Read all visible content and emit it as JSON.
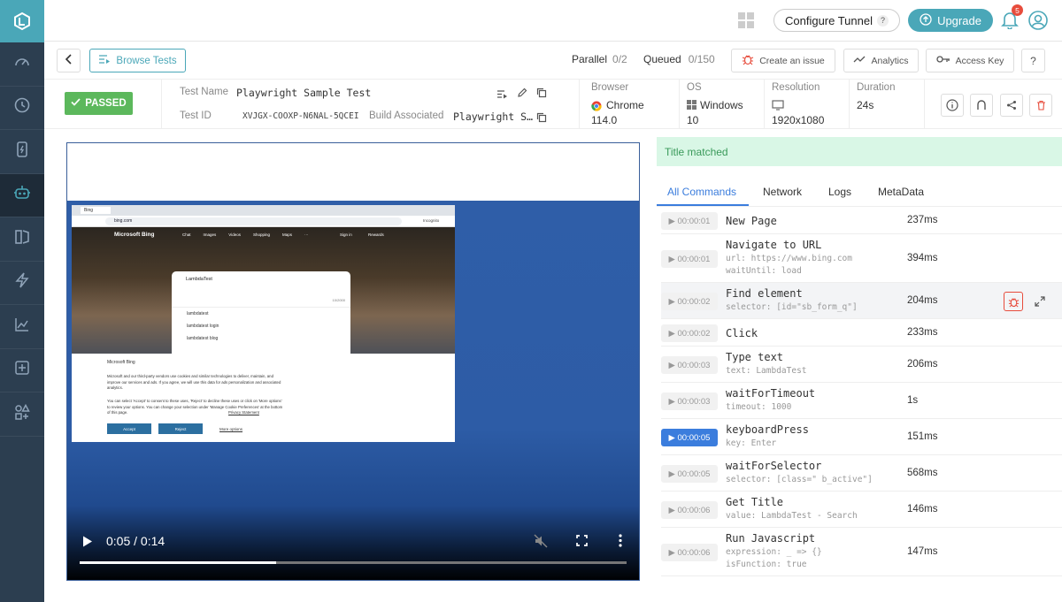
{
  "header": {
    "configure_tunnel": "Configure Tunnel",
    "help_glyph": "?",
    "upgrade": "Upgrade",
    "notifications_count": "5"
  },
  "toolbar": {
    "browse_tests": "Browse Tests",
    "parallel_label": "Parallel",
    "parallel_value": "0/2",
    "queued_label": "Queued",
    "queued_value": "0/150",
    "create_issue": "Create an issue",
    "analytics": "Analytics",
    "access_key": "Access Key",
    "help": "?"
  },
  "test": {
    "status": "PASSED",
    "name_label": "Test Name",
    "name": "Playwright Sample Test",
    "id_label": "Test ID",
    "id": "XVJGX-COOXP-N6NAL-5QCEI",
    "build_label": "Build Associated",
    "build": "Playwright S…",
    "browser_label": "Browser",
    "browser": "Chrome",
    "browser_version": "114.0",
    "os_label": "OS",
    "os": "Windows",
    "os_version": "10",
    "resolution_label": "Resolution",
    "resolution": "1920x1080",
    "duration_label": "Duration",
    "duration": "24s"
  },
  "video": {
    "current": "0:05",
    "total": "0:14",
    "separator": " / ",
    "progress": 0.36
  },
  "page_preview": {
    "tab_title": "Bing",
    "url": "bing.com",
    "incognito": "Incognito",
    "brand": "Microsoft Bing",
    "nav": [
      "Chat",
      "Images",
      "Videos",
      "Shopping",
      "Maps",
      "···"
    ],
    "signin": "Sign in",
    "rewards": "Rewards",
    "query": "LambdaTest",
    "counter": "10/2000",
    "suggestions": [
      "lambdatest",
      "lambdatest login",
      "lambdatest blog"
    ],
    "consent_brand": "Microsoft Bing",
    "consent_text1": "Microsoft and our third-party vendors use cookies and similar technologies to deliver, maintain, and improve our services and ads. If you agree, we will use this data for ads personalization and associated analytics.",
    "consent_text2": "You can select 'Accept' to consent to these uses, 'Reject' to decline these uses or click on 'More options' to review your options. You can change your selection under 'Manage Cookie Preferences' at the bottom of this page.",
    "privacy": "Privacy Statement",
    "accept": "Accept",
    "reject": "Reject",
    "more": "More options"
  },
  "panel": {
    "banner": "Title matched",
    "tabs": [
      "All Commands",
      "Network",
      "Logs",
      "MetaData"
    ],
    "commands": [
      {
        "time": "00:00:01",
        "name": "New Page",
        "details": [],
        "duration": "237ms"
      },
      {
        "time": "00:00:01",
        "name": "Navigate to URL",
        "details": [
          "url: https://www.bing.com",
          "waitUntil: load"
        ],
        "duration": "394ms"
      },
      {
        "time": "00:00:02",
        "name": "Find element",
        "details": [
          "selector: [id=\"sb_form_q\"]"
        ],
        "duration": "204ms"
      },
      {
        "time": "00:00:02",
        "name": "Click",
        "details": [],
        "duration": "233ms"
      },
      {
        "time": "00:00:03",
        "name": "Type text",
        "details": [
          "text: LambdaTest"
        ],
        "duration": "206ms"
      },
      {
        "time": "00:00:03",
        "name": "waitForTimeout",
        "details": [
          "timeout: 1000"
        ],
        "duration": "1s"
      },
      {
        "time": "00:00:05",
        "name": "keyboardPress",
        "details": [
          "key: Enter"
        ],
        "duration": "151ms"
      },
      {
        "time": "00:00:05",
        "name": "waitForSelector",
        "details": [
          "selector: [class=\" b_active\"]"
        ],
        "duration": "568ms"
      },
      {
        "time": "00:00:06",
        "name": "Get Title",
        "details": [
          "value: LambdaTest - Search"
        ],
        "duration": "146ms"
      },
      {
        "time": "00:00:06",
        "name": "Run Javascript",
        "details": [
          "expression: _ => {}",
          "isFunction: true"
        ],
        "duration": "147ms"
      }
    ]
  },
  "colors": {
    "sidebar": "#2c3e50",
    "accent": "#4aa7b8",
    "passed": "#5cb85c",
    "active_time": "#3b7ddd",
    "banner": "#d9f7e6"
  }
}
